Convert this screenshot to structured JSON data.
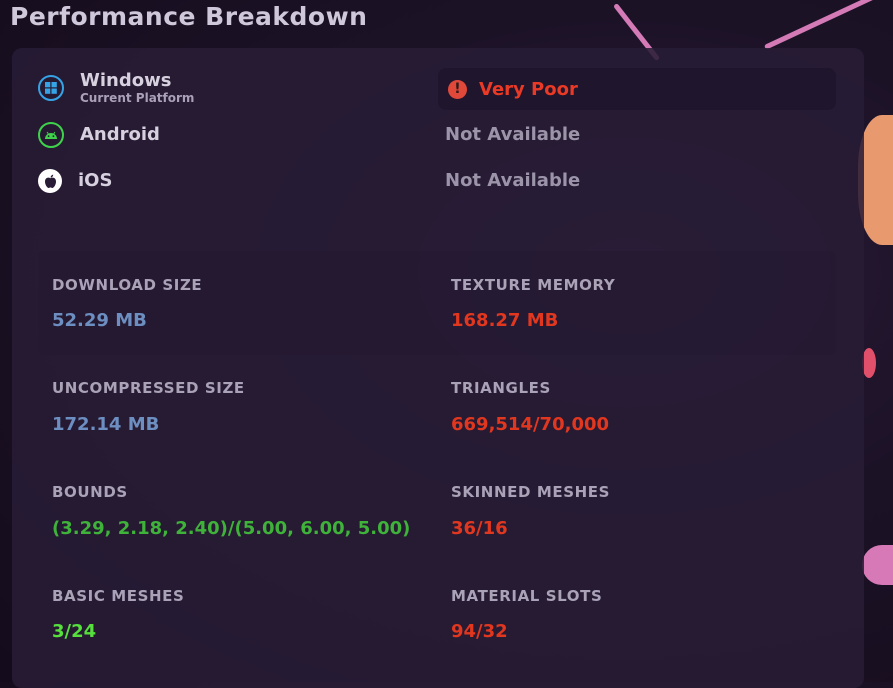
{
  "title": "Performance Breakdown",
  "platforms": [
    {
      "name": "Windows",
      "subtitle": "Current Platform",
      "icon": "windows-icon",
      "status": "Very Poor",
      "status_icon": "exclamation-icon",
      "status_color": "#ea3a26"
    },
    {
      "name": "Android",
      "subtitle": "",
      "icon": "android-icon",
      "status": "Not Available"
    },
    {
      "name": "iOS",
      "subtitle": "",
      "icon": "apple-icon",
      "status": "Not Available"
    }
  ],
  "stats": [
    {
      "label": "DOWNLOAD SIZE",
      "value": "52.29 MB",
      "color": "#6d8ec0"
    },
    {
      "label": "TEXTURE MEMORY",
      "value": "168.27 MB",
      "color": "#e2371f"
    },
    {
      "label": "UNCOMPRESSED SIZE",
      "value": "172.14 MB",
      "color": "#6d8ec0"
    },
    {
      "label": "TRIANGLES",
      "value": "669,514/70,000",
      "color": "#e2371f"
    },
    {
      "label": "BOUNDS",
      "value": "(3.29, 2.18, 2.40)/(5.00, 6.00, 5.00)",
      "color": "#3fb23a"
    },
    {
      "label": "SKINNED MESHES",
      "value": "36/16",
      "color": "#e2371f"
    },
    {
      "label": "BASIC MESHES",
      "value": "3/24",
      "color": "#55e03c"
    },
    {
      "label": "MATERIAL SLOTS",
      "value": "94/32",
      "color": "#e2371f"
    }
  ]
}
